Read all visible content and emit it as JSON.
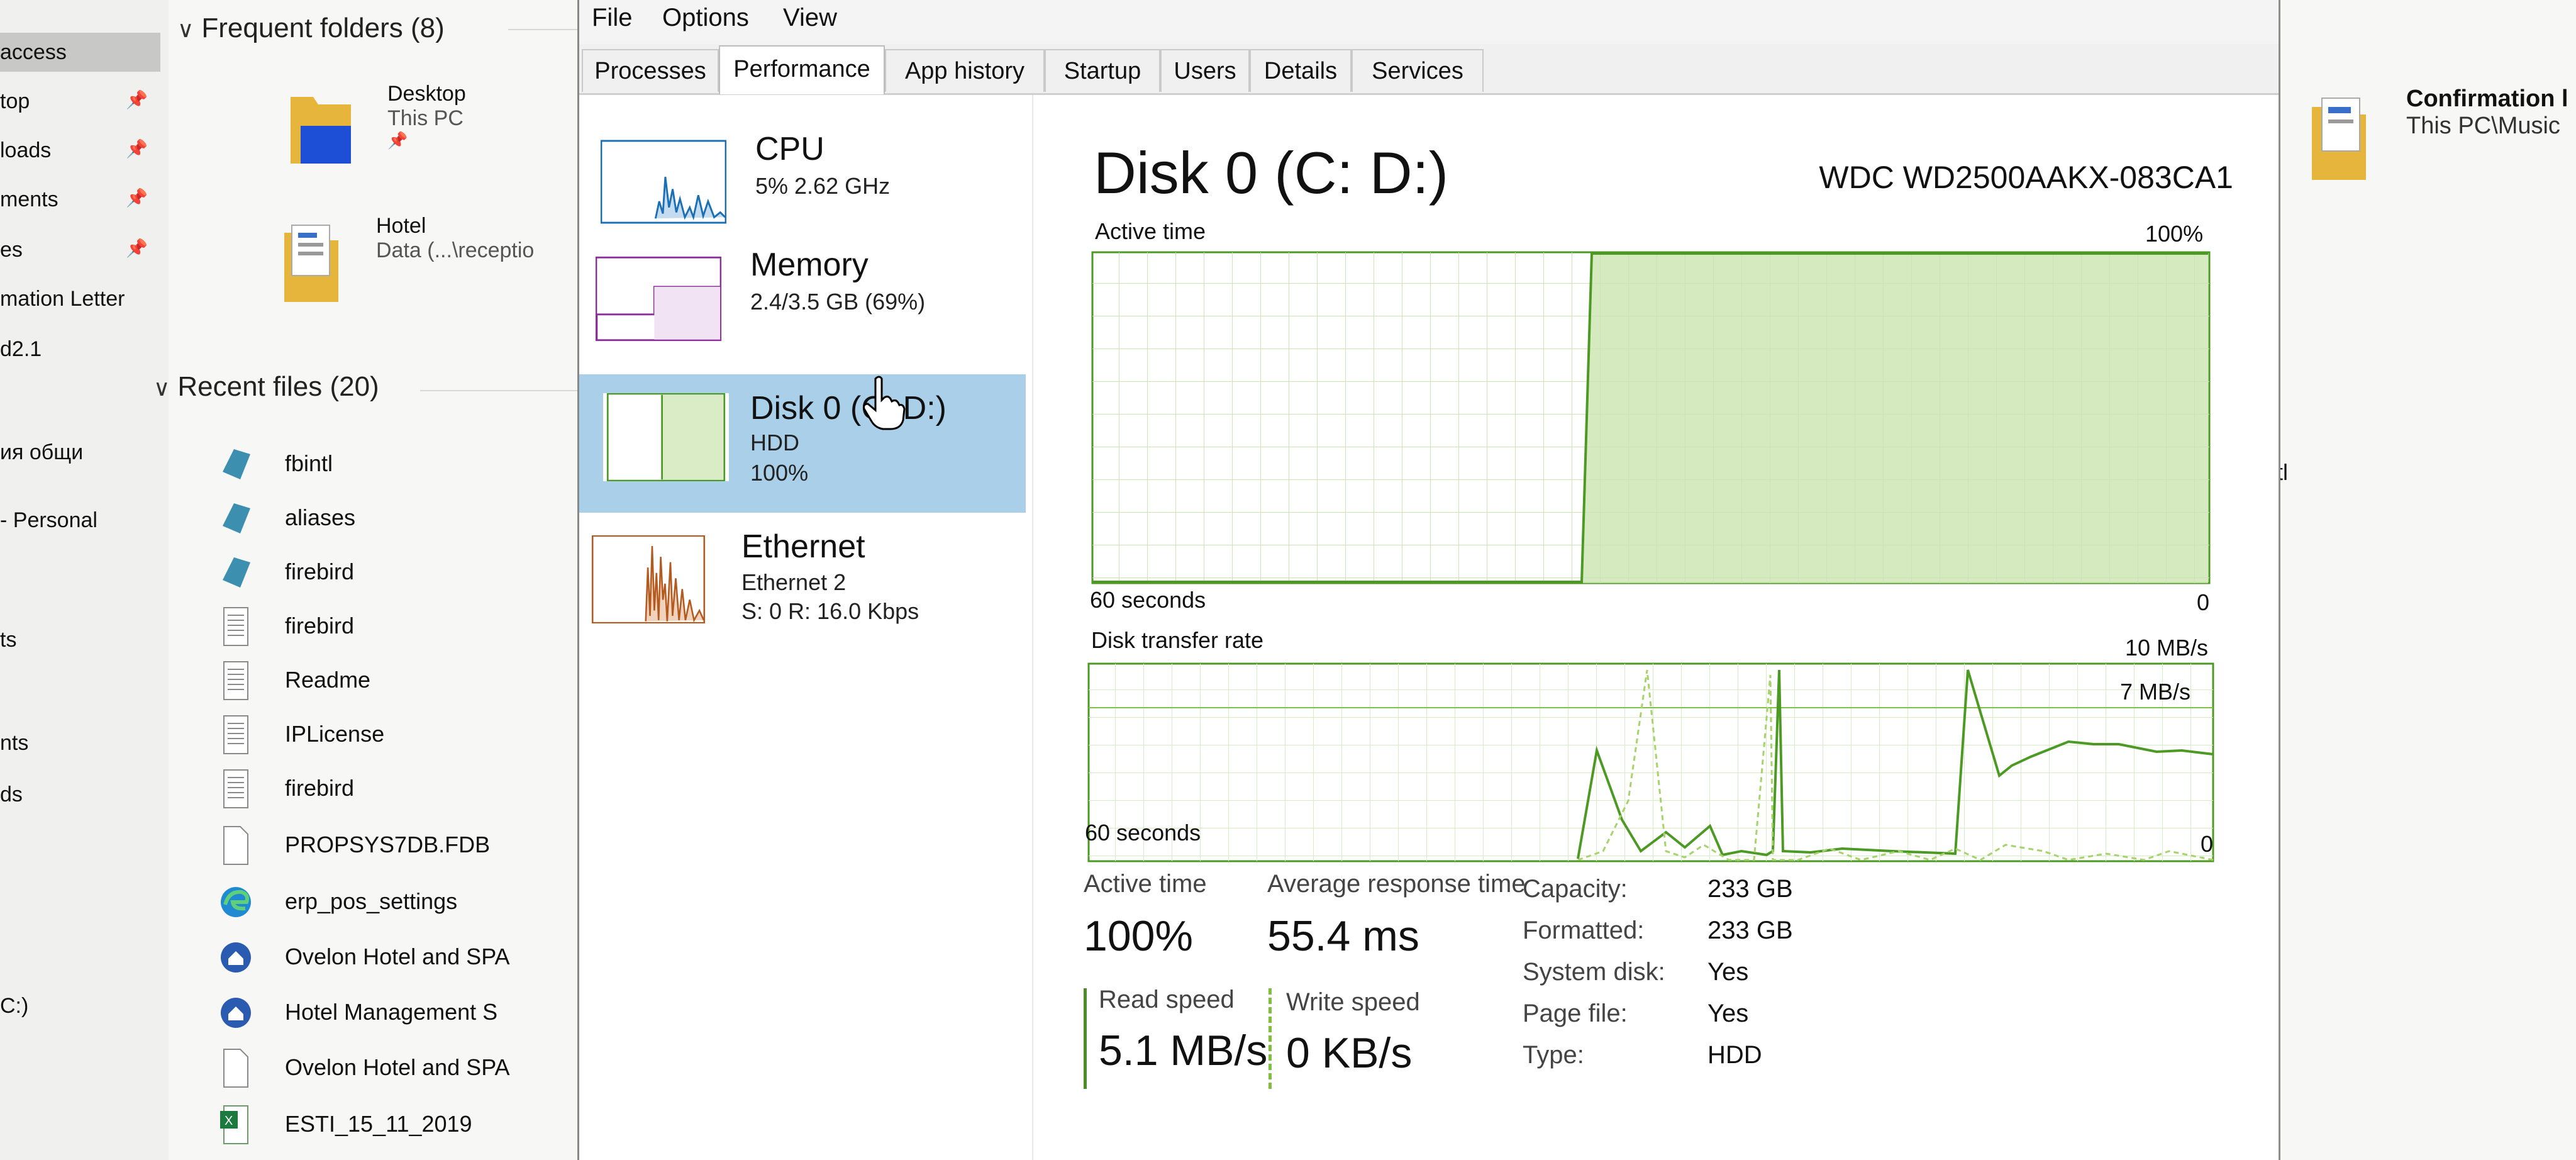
{
  "explorer": {
    "nav": {
      "items": [
        "access",
        "top",
        "loads",
        "ments",
        "es",
        "mation Letter",
        "d2.1",
        "ия общи",
        "- Personal",
        "ts",
        "nts",
        "ds",
        "C:)"
      ]
    },
    "frequent": {
      "header": "Frequent folders (8)",
      "items": [
        {
          "name": "Desktop",
          "location": "This PC"
        },
        {
          "name": "Hotel",
          "location": "Data (...\\receptio"
        }
      ]
    },
    "recent": {
      "header": "Recent files (20)",
      "items": [
        "fbintl",
        "aliases",
        "firebird",
        "firebird",
        "Readme",
        "IPLicense",
        "firebird",
        "PROPSYS7DB.FDB",
        "erp_pos_settings",
        "Ovelon Hotel and SPA",
        "Hotel Management S",
        "Ovelon Hotel and SPA",
        "ESTI_15_11_2019"
      ]
    },
    "right": {
      "title": "Confirmation l",
      "path": "This PC\\Music",
      "fragment": "tl"
    }
  },
  "task_manager": {
    "menu": [
      "File",
      "Options",
      "View"
    ],
    "tabs": [
      "Processes",
      "Performance",
      "App history",
      "Startup",
      "Users",
      "Details",
      "Services"
    ],
    "selected_tab": "Performance",
    "resources": [
      {
        "name": "CPU",
        "sub1": "5%  2.62 GHz",
        "sub2": "",
        "color": "#1a6fb5"
      },
      {
        "name": "Memory",
        "sub1": "2.4/3.5 GB (69%)",
        "sub2": "",
        "color": "#8b2f9a"
      },
      {
        "name": "Disk 0 (C: D:)",
        "sub1": "HDD",
        "sub2": "100%",
        "color": "#4c9a24"
      },
      {
        "name": "Ethernet",
        "sub1": "Ethernet 2",
        "sub2": "S: 0  R: 16.0 Kbps",
        "color": "#b35a1f"
      }
    ],
    "disk": {
      "title": "Disk 0 (C: D:)",
      "model": "WDC WD2500AAKX-083CA1",
      "active_graph": {
        "label": "Active time",
        "max_label": "100%",
        "time_label": "60 seconds",
        "min_label": "0"
      },
      "transfer_graph": {
        "label": "Disk transfer rate",
        "max_label": "10 MB/s",
        "mid_label": "7 MB/s",
        "time_label": "60 seconds",
        "min_label": "0"
      },
      "stats": {
        "active_time_label": "Active time",
        "active_time": "100%",
        "response_label": "Average response time",
        "response": "55.4 ms",
        "read_label": "Read speed",
        "read": "5.1 MB/s",
        "write_label": "Write speed",
        "write": "0 KB/s"
      },
      "props": [
        {
          "k": "Capacity:",
          "v": "233 GB"
        },
        {
          "k": "Formatted:",
          "v": "233 GB"
        },
        {
          "k": "System disk:",
          "v": "Yes"
        },
        {
          "k": "Page file:",
          "v": "Yes"
        },
        {
          "k": "Type:",
          "v": "HDD"
        }
      ]
    }
  }
}
